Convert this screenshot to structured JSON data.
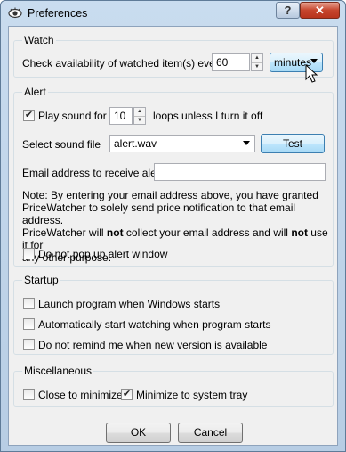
{
  "window": {
    "title": "Preferences",
    "help_label": "?",
    "close_label": "✕"
  },
  "watch": {
    "group_label": "Watch",
    "check_label": "Check availability of watched item(s) every",
    "interval_value": "60",
    "unit_value": "minutes"
  },
  "alert": {
    "group_label": "Alert",
    "play_sound_label": "Play sound for",
    "play_sound_checked": true,
    "loops_value": "10",
    "loops_label": "loops unless I turn it off",
    "sound_file_label": "Select sound file",
    "sound_file_value": "alert.wav",
    "test_label": "Test",
    "email_label": "Email address to receive alert",
    "email_value": "",
    "note_line1": "Note: By entering your email address above, you have granted",
    "note_line2": "PriceWatcher to solely send price notification to that email address.",
    "note_line3_a": "PriceWatcher will ",
    "note_line3_b": "not",
    "note_line3_c": " collect your email address and will ",
    "note_line3_d": "not",
    "note_line3_e": " use it for",
    "note_line4": "any other purpose.",
    "no_popup_label": "Do not pop up alert window",
    "no_popup_checked": false
  },
  "startup": {
    "group_label": "Startup",
    "launch_label": "Launch program when Windows starts",
    "launch_checked": false,
    "auto_watch_label": "Automatically start watching when program starts",
    "auto_watch_checked": false,
    "no_remind_label": "Do not remind me when new version is available",
    "no_remind_checked": false
  },
  "misc": {
    "group_label": "Miscellaneous",
    "close_min_label": "Close to minimize",
    "close_min_checked": false,
    "tray_label": "Minimize to system tray",
    "tray_checked": true
  },
  "footer": {
    "ok_label": "OK",
    "cancel_label": "Cancel"
  }
}
